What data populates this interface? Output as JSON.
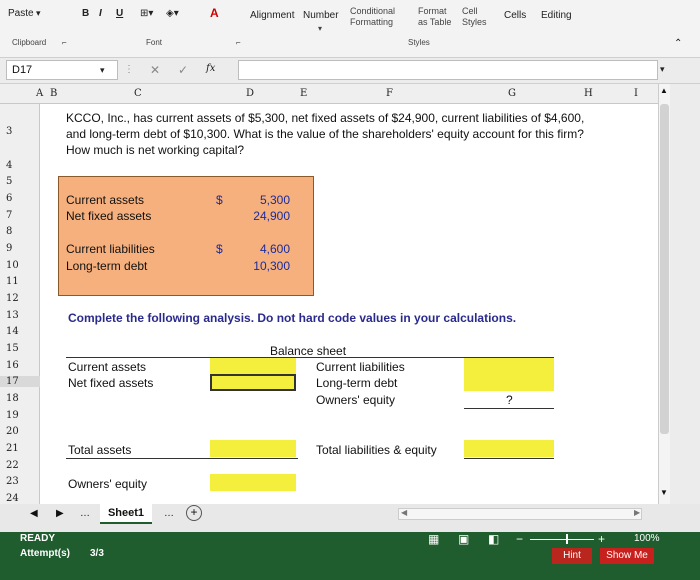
{
  "ribbon": {
    "paste": "Paste",
    "clipboard": "Clipboard",
    "bold": "B",
    "italic": "I",
    "underline": "U",
    "font": "Font",
    "alignment": "Alignment",
    "number": "Number",
    "conditional_formatting": "Conditional Formatting",
    "format_as_table": "Format as Table",
    "cell_styles": "Cell Styles",
    "styles": "Styles",
    "cells": "Cells",
    "editing": "Editing"
  },
  "formula_bar": {
    "name_box": "D17",
    "fx": "fx",
    "value": ""
  },
  "columns": [
    "A",
    "B",
    "C",
    "D",
    "E",
    "F",
    "G",
    "H",
    "I"
  ],
  "rows": [
    "3",
    "4",
    "5",
    "6",
    "7",
    "8",
    "9",
    "10",
    "11",
    "12",
    "13",
    "14",
    "15",
    "16",
    "17",
    "18",
    "19",
    "20",
    "21",
    "22",
    "23",
    "24"
  ],
  "problem": {
    "line1": "KCCO, Inc., has current assets of $5,300, net fixed assets of $24,900, current liabilities of $4,600,",
    "line2": "and long-term debt of $10,300. What is the value of the shareholders' equity account for this firm?",
    "line3": "How much is net working capital?"
  },
  "inputs": {
    "current_assets_label": "Current assets",
    "net_fixed_assets_label": "Net fixed assets",
    "current_liabilities_label": "Current liabilities",
    "long_term_debt_label": "Long-term debt",
    "dollar1": "$",
    "dollar2": "$",
    "current_assets": "5,300",
    "net_fixed_assets": "24,900",
    "current_liabilities": "4,600",
    "long_term_debt": "10,300"
  },
  "instructions": "Complete the following analysis. Do not hard code values in your calculations.",
  "balance_sheet": {
    "title": "Balance sheet",
    "current_assets": "Current assets",
    "net_fixed_assets": "Net fixed assets",
    "current_liabilities": "Current liabilities",
    "long_term_debt": "Long-term debt",
    "owners_equity": "Owners' equity",
    "owners_equity_value": "?",
    "total_assets": "Total assets",
    "total_liabilities_equity": "Total liabilities & equity",
    "owners_equity2": "Owners' equity"
  },
  "sheet_tab": "Sheet1",
  "status": {
    "ready": "READY",
    "zoom": "100%"
  },
  "footer": {
    "attempts_label": "Attempt(s)",
    "attempts_value": "3/3",
    "hint": "Hint",
    "show_me": "Show Me"
  },
  "colors": {
    "input_box": "#f5b07d",
    "answer_cell": "#f4ef3c",
    "footer_bg": "#1f5c2e",
    "show_me_btn": "#c8201c"
  }
}
